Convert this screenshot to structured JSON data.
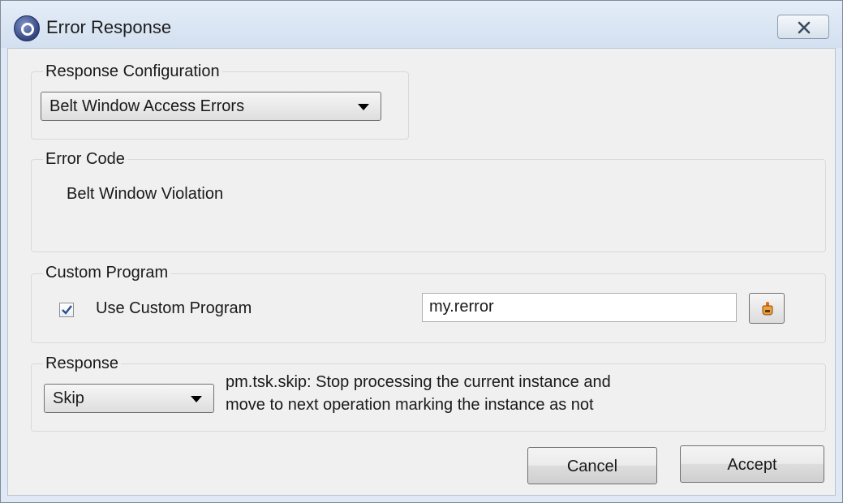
{
  "window": {
    "title": "Error Response",
    "close_icon": "close-x-icon",
    "app_icon": "app-logo-icon"
  },
  "response_configuration": {
    "label": "Response Configuration",
    "selected": "Belt Window Access Errors"
  },
  "error_code": {
    "label": "Error Code",
    "value": "Belt Window Violation"
  },
  "custom_program": {
    "label": "Custom Program",
    "checkbox_label": "Use Custom Program",
    "checked": true,
    "program_value": "my.rerror",
    "edit_icon": "hand-pointer-icon"
  },
  "response": {
    "label": "Response",
    "selected": "Skip",
    "description_line1": "pm.tsk.skip: Stop processing the current instance and",
    "description_line2": "move to next operation marking the instance as not"
  },
  "buttons": {
    "cancel": "Cancel",
    "accept": "Accept"
  }
}
